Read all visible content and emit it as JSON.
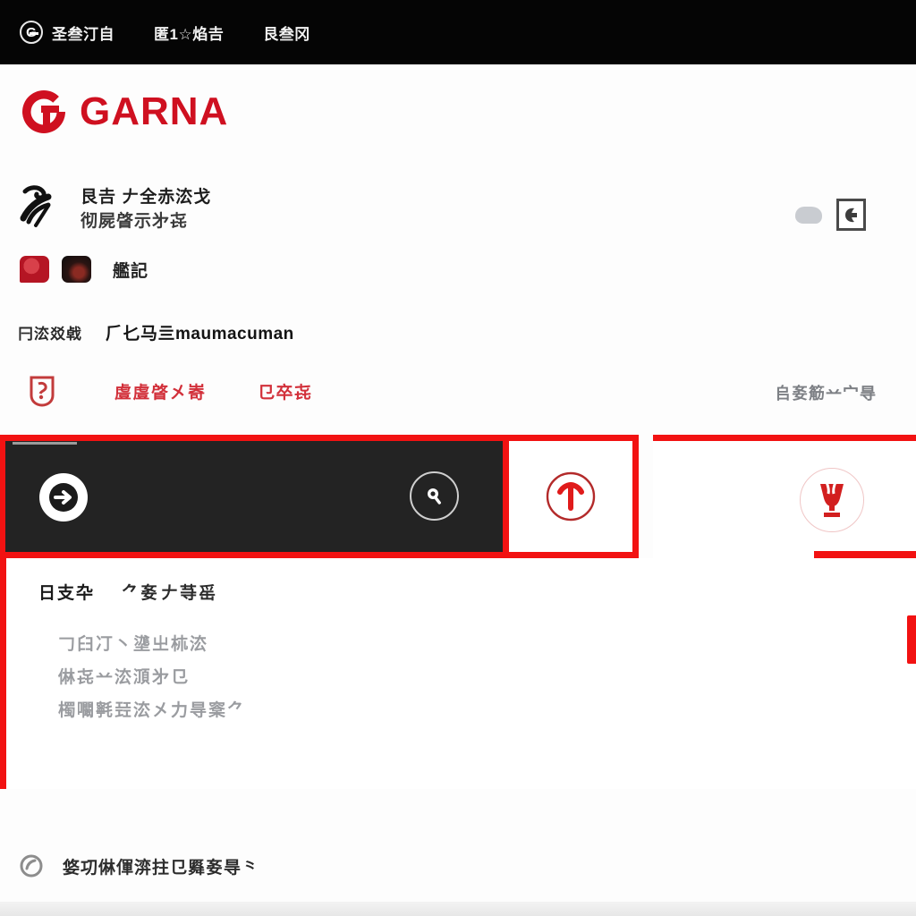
{
  "topnav": {
    "brand_icon": "circle-g-logo-icon",
    "items": [
      {
        "label": "圣叁汀自"
      },
      {
        "label": "匿1☆焰𠮷"
      },
      {
        "label": "艮叁冈"
      }
    ]
  },
  "brand": {
    "logo_icon": "garna-g-mark-icon",
    "wordmark": "GARNA",
    "color": "#cf1020"
  },
  "account": {
    "avatar_icon": "user-avatar-icon",
    "line1": "艮𠮷 𠂇全赤㳒戈",
    "line2": "彻屍䁈示㐧㐂",
    "badges": [
      {
        "icon": "red-speech-badge-icon"
      },
      {
        "icon": "dark-thumbnail-icon"
      }
    ],
    "badge_label": "艦記",
    "right_controls": [
      {
        "icon": "gray-blob-icon"
      },
      {
        "icon": "boxed-glyph-icon"
      }
    ]
  },
  "section": {
    "kicker": "𠔼㳒㸚㦸",
    "title": "⺁𠤎马亖maumacuman"
  },
  "links": {
    "shield_icon": "red-shield-badge-icon",
    "items": [
      {
        "label": "䖒䖒䁈㐅㟢"
      },
      {
        "label": "㔾卒㐂"
      }
    ],
    "note": "𠂤㚣䈥䒑宀㝵"
  },
  "strip": {
    "play_icon": "arrow-right-circle-icon",
    "search_icon": "search-icon",
    "mid_card_icon": "anchor-t-circle-icon",
    "right_card_icon": "trophy-icon",
    "accent_color": "#f21212"
  },
  "content": {
    "heading_left": "日支卆",
    "heading_right": "⺈㚣𥅎𠂇䒭䍃",
    "lines": [
      {
        "text": "𠃌𦥑㓅丶㙙㞢𣏕㳒"
      },
      {
        "text": "㑣㐂䒑㳒㴿㐧㔾"
      },
      {
        "text": "㯮㘚㲰㠭㳒㐅力㝵㮤⺈"
      }
    ]
  },
  "footer": {
    "icon": "circle-arrow-icon",
    "text": "㛜㓛㑣㑮㴒拄㔾䑞㚣㝵⺀"
  }
}
